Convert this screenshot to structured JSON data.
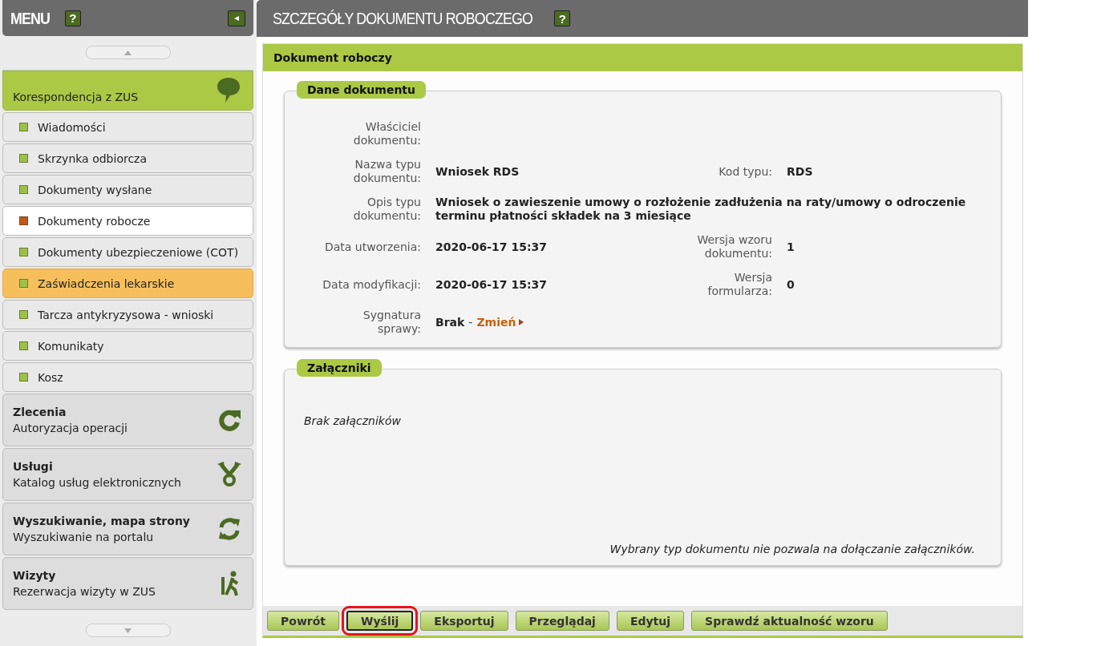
{
  "sidebar": {
    "title": "MENU",
    "help": "?",
    "sections": [
      {
        "subtitle": "Korespondencja z ZUS",
        "expanded": true,
        "items": [
          {
            "label": "Wiadomości",
            "selected": false,
            "hovered": false
          },
          {
            "label": "Skrzynka odbiorcza",
            "selected": false,
            "hovered": false
          },
          {
            "label": "Dokumenty wysłane",
            "selected": false,
            "hovered": false
          },
          {
            "label": "Dokumenty robocze",
            "selected": true,
            "hovered": false
          },
          {
            "label": "Dokumenty ubezpieczeniowe (COT)",
            "selected": false,
            "hovered": false
          },
          {
            "label": "Zaświadczenia lekarskie",
            "selected": false,
            "hovered": true
          },
          {
            "label": "Tarcza antykryzysowa - wnioski",
            "selected": false,
            "hovered": false
          },
          {
            "label": "Komunikaty",
            "selected": false,
            "hovered": false
          },
          {
            "label": "Kosz",
            "selected": false,
            "hovered": false
          }
        ]
      },
      {
        "title": "Zlecenia",
        "subtitle": "Autoryzacja operacji",
        "expanded": false
      },
      {
        "title": "Usługi",
        "subtitle": "Katalog usług elektronicznych",
        "expanded": false
      },
      {
        "title": "Wyszukiwanie, mapa strony",
        "subtitle": "Wyszukiwanie na portalu",
        "expanded": false
      },
      {
        "title": "Wizyty",
        "subtitle": "Rezerwacja wizyty w ZUS",
        "expanded": false
      }
    ]
  },
  "page": {
    "title": "SZCZEGÓŁY DOKUMENTU ROBOCZEGO",
    "help": "?",
    "panel_title": "Dokument roboczy",
    "document": {
      "legend": "Dane dokumentu",
      "rows": [
        {
          "cells": [
            {
              "label": "Właściciel\ndokumentu:"
            }
          ]
        },
        {
          "cells": [
            {
              "label": "Nazwa typu\ndokumentu:",
              "value": "Wniosek RDS"
            },
            {
              "label": "Kod typu:",
              "value": "RDS"
            }
          ]
        },
        {
          "cells": [
            {
              "label": "Opis typu\ndokumentu:",
              "value": "Wniosek o zawieszenie umowy o rozłożenie zadłużenia na raty/umowy o odroczenie terminu płatności składek na 3 miesiące"
            }
          ]
        },
        {
          "cells": [
            {
              "label": "Data utworzenia:",
              "value": "2020-06-17 15:37"
            },
            {
              "label": "Wersja wzoru\ndokumentu:",
              "value": "1"
            }
          ]
        },
        {
          "cells": [
            {
              "label": "Data modyfikacji:",
              "value": "2020-06-17 15:37"
            },
            {
              "label": "Wersja\nformularza:",
              "value": "0"
            }
          ]
        },
        {
          "cells": [
            {
              "label": "Sygnatura\nsprawy:",
              "value": "Brak",
              "separator": "-",
              "link": "Zmień"
            }
          ]
        }
      ]
    },
    "attachments": {
      "legend": "Załączniki",
      "empty": "Brak załączników",
      "note": "Wybrany typ dokumentu nie pozwala na dołączanie załączników."
    },
    "buttons": [
      {
        "label": "Powrót",
        "highlighted": false
      },
      {
        "label": "Wyślij",
        "highlighted": true
      },
      {
        "label": "Eksportuj",
        "highlighted": false
      },
      {
        "label": "Przeglądaj",
        "highlighted": false
      },
      {
        "label": "Edytuj",
        "highlighted": false
      },
      {
        "label": "Sprawdź aktualność wzoru",
        "highlighted": false
      }
    ]
  }
}
